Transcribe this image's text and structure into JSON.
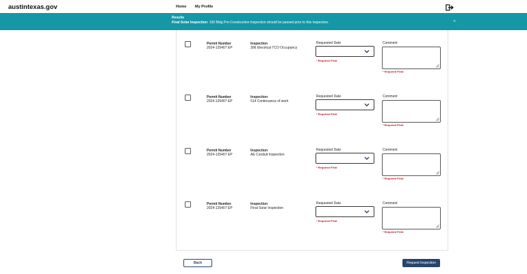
{
  "header": {
    "brand": "austintexas.gov",
    "nav": {
      "home": "Home",
      "profile": "My Profile"
    },
    "logout_icon": "logout-icon"
  },
  "banner": {
    "title": "Results",
    "message_strong": "Final Solar Inspection",
    "message_rest": ": 100 Bldg Pre-Construction Inspection should be passed prior to this inspection.",
    "close": "×",
    "color": "#1597a6"
  },
  "labels": {
    "permit": "Permit Number",
    "inspection": "Inspection",
    "requested_date": "Requested Date",
    "comment": "Comment",
    "required": "* Required Field"
  },
  "rows": [
    {
      "permit": "2024-125407 EP",
      "inspection": "306 Electrical TCO Occupancy",
      "date": "",
      "comment": ""
    },
    {
      "permit": "2024-125407 EP",
      "inspection": "514 Continuance of work",
      "date": "",
      "comment": ""
    },
    {
      "permit": "2024-125407 EP",
      "inspection": "AE Conduit Inspection",
      "date": "",
      "comment": ""
    },
    {
      "permit": "2024-125407 EP",
      "inspection": "Final Solar Inspection",
      "date": "",
      "comment": ""
    }
  ],
  "footer": {
    "back": "Back",
    "request": "Request Inspection"
  },
  "colors": {
    "primary": "#27456b",
    "required": "#c0161a"
  }
}
